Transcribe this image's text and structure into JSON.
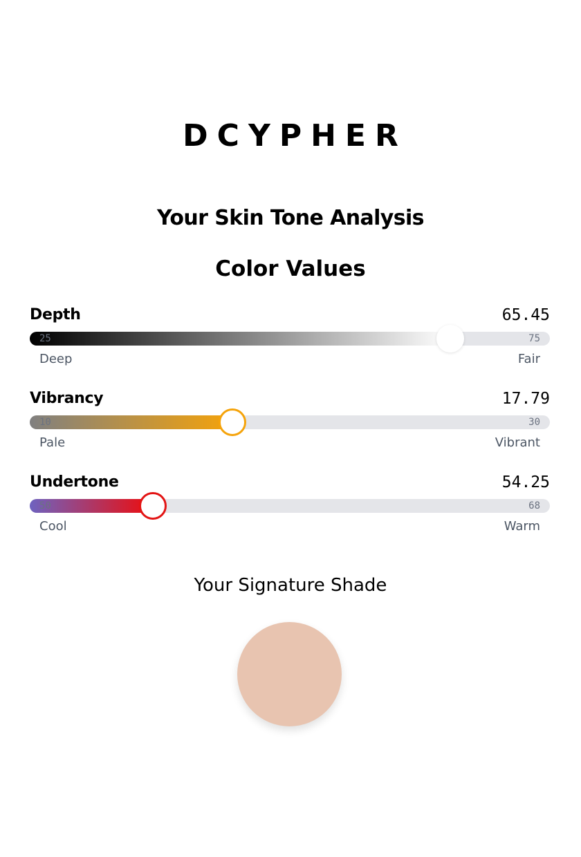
{
  "brand": {
    "logo_text": "DCYPHER"
  },
  "headline": "Your Skin Tone Analysis",
  "section_title": "Color Values",
  "metrics": [
    {
      "name": "Depth",
      "value": "65.45",
      "min": "25",
      "max": "75",
      "left_label": "Deep",
      "right_label": "Fair",
      "gradient_start": "#000000",
      "gradient_end": "#ffffff",
      "thumb_border": "#ffffff"
    },
    {
      "name": "Vibrancy",
      "value": "17.79",
      "min": "10",
      "max": "30",
      "left_label": "Pale",
      "right_label": "Vibrant",
      "gradient_start": "#808080",
      "gradient_end": "#f5a30a",
      "thumb_border": "#f5a30a"
    },
    {
      "name": "Undertone",
      "value": "54.25",
      "min": "50",
      "max": "68",
      "left_label": "Cool",
      "right_label": "Warm",
      "gradient_start": "#6e62c0",
      "gradient_end": "#ee0c0c",
      "thumb_border": "#e31414"
    }
  ],
  "signature": {
    "title": "Your Signature Shade",
    "color": "#e8c4b0"
  }
}
